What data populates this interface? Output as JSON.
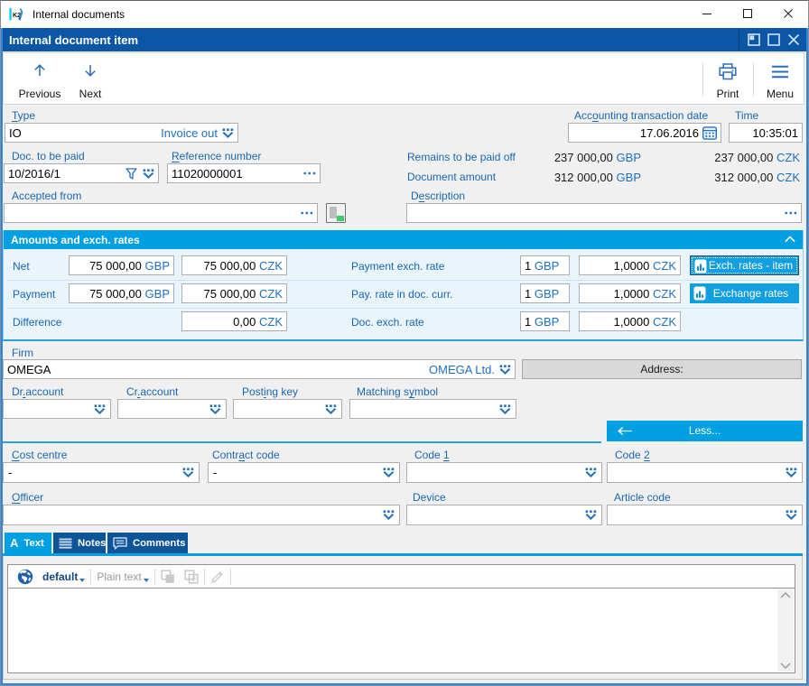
{
  "window": {
    "title": "Internal documents",
    "logo": "K2",
    "controls": {
      "minimize": "minimize",
      "maximize": "maximize",
      "close": "close"
    }
  },
  "dialog": {
    "title": "Internal document item",
    "controls": {
      "dock": "dock",
      "maximize": "maximize",
      "close": "close"
    }
  },
  "toolbar": {
    "previous": "Previous",
    "next": "Next",
    "print": "Print",
    "menu": "Menu"
  },
  "colors": {
    "accent_blue": "#0b57a6",
    "cyan": "#00a0e2",
    "label_blue": "#1767b2",
    "value_blue": "#1d6fc0",
    "tab_dark_blue": "#0d5499",
    "panel_bg": "#eaf4fb",
    "green": "#3ecb6e"
  },
  "fields": {
    "type": {
      "label_mn": "T",
      "label_post": "ype",
      "value": "IO",
      "display": "Invoice out"
    },
    "acc_date": {
      "label_pre": "Acc",
      "label_mn": "o",
      "label_post": "unting transaction date",
      "value": "17.06.2016"
    },
    "time": {
      "label": "Time",
      "value": "10:35:01"
    },
    "doc_to_pay": {
      "label": "Doc. to be paid",
      "value": "10/2016/1"
    },
    "reference": {
      "label_mn": "R",
      "label_post": "eference number",
      "value": "11020000001"
    },
    "remains": {
      "label": "Remains to be paid off",
      "amount_cur": "237 000,00",
      "cur": "GBP",
      "amount_base": "237 000,00",
      "base": "CZK"
    },
    "doc_amount": {
      "label": "Document amount",
      "amount_cur": "312 000,00",
      "cur": "GBP",
      "amount_base": "312 000,00",
      "base": "CZK"
    },
    "accepted_from": {
      "label": "Accepted from",
      "value": ""
    },
    "description": {
      "label_pre": "D",
      "label_mn": "e",
      "label_post": "scription",
      "value": ""
    },
    "firm": {
      "label": "Firm",
      "value": "OMEGA",
      "display": "OMEGA Ltd."
    },
    "address": {
      "label": "Address:"
    },
    "dr_account": {
      "label_pre": "Dr",
      "label_mn": ".",
      "label_post": "account",
      "value": ""
    },
    "cr_account": {
      "label_pre": "Cr",
      "label_mn": ".",
      "label_post": "account",
      "value": ""
    },
    "posting_key": {
      "label_pre": "Post",
      "label_mn": "i",
      "label_post": "ng key",
      "value": ""
    },
    "matching_symbol": {
      "label_pre": "Matching s",
      "label_mn": "y",
      "label_post": "mbol",
      "value": ""
    },
    "cost_centre": {
      "label_mn": "C",
      "label_post": "ost centre",
      "value": "-"
    },
    "contract_code": {
      "label_pre": "Contr",
      "label_mn": "a",
      "label_post": "ct code",
      "value": "-"
    },
    "code1": {
      "label_pre": "Code ",
      "label_mn": "1",
      "label_post": "",
      "value": ""
    },
    "code2": {
      "label_pre": "Code ",
      "label_mn": "2",
      "label_post": "",
      "value": ""
    },
    "officer": {
      "label_mn": "O",
      "label_post": "fficer",
      "value": ""
    },
    "device": {
      "label": "Device",
      "value": ""
    },
    "article_code": {
      "label": "Article code",
      "value": ""
    }
  },
  "amounts": {
    "header": "Amounts and exch. rates",
    "net": {
      "label": "Net",
      "amount_cur": "75 000,00",
      "cur": "GBP",
      "amount_base": "75 000,00",
      "base": "CZK"
    },
    "payment": {
      "label": "Payment",
      "amount_cur": "75 000,00",
      "cur": "GBP",
      "amount_base": "75 000,00",
      "base": "CZK"
    },
    "difference": {
      "label": "Difference",
      "amount_base": "0,00",
      "base": "CZK"
    },
    "payment_rate": {
      "label": "Payment exch. rate",
      "unit": "1",
      "unit_cur": "GBP",
      "rate": "1,0000",
      "rate_cur": "CZK"
    },
    "pay_rate_doc": {
      "label": "Pay. rate in doc. curr.",
      "unit": "1",
      "unit_cur": "GBP",
      "rate": "1,0000",
      "rate_cur": "CZK"
    },
    "doc_rate": {
      "label": "Doc. exch. rate",
      "unit": "1",
      "unit_cur": "GBP",
      "rate": "1,0000",
      "rate_cur": "CZK"
    },
    "btn_exch_item": "Exch. rates - item",
    "btn_exch": "Exchange rates"
  },
  "less_button": {
    "label": "Less..."
  },
  "tabs": [
    {
      "label": "Text",
      "active": true
    },
    {
      "label": "Notes",
      "active": false
    },
    {
      "label": "Comments",
      "active": false
    }
  ],
  "editor": {
    "language": "default",
    "format": "Plain text",
    "content": ""
  }
}
